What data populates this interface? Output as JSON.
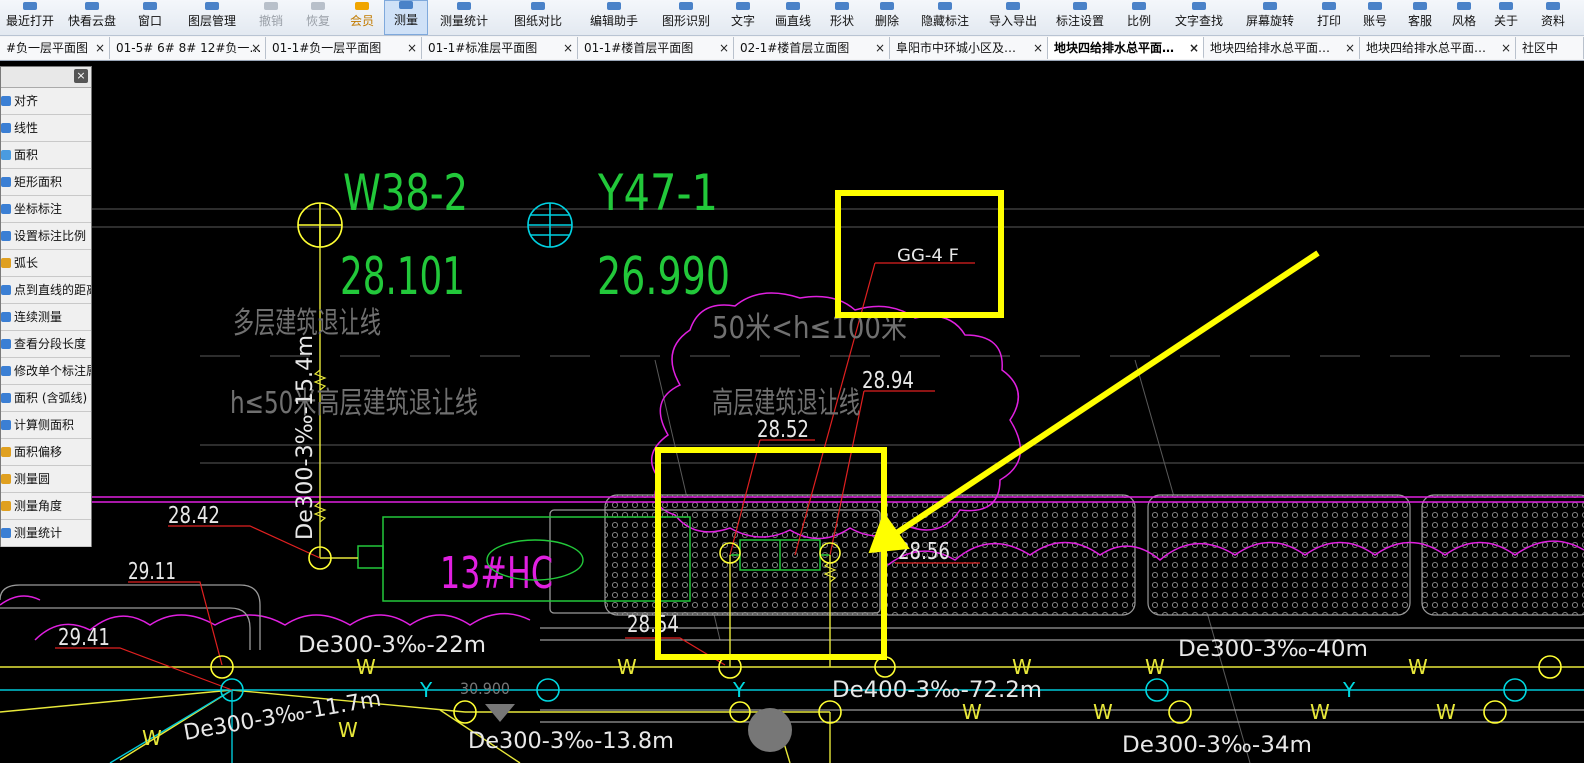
{
  "toolbar": {
    "items": [
      {
        "label": "最近打开",
        "state": "normal"
      },
      {
        "label": "快看云盘",
        "state": "normal"
      },
      {
        "label": "窗口",
        "state": "normal"
      },
      {
        "label": "图层管理",
        "state": "normal"
      },
      {
        "label": "撤销",
        "state": "disabled"
      },
      {
        "label": "恢复",
        "state": "disabled"
      },
      {
        "label": "会员",
        "state": "orange"
      },
      {
        "label": "测量",
        "state": "active"
      },
      {
        "label": "测量统计",
        "state": "normal"
      },
      {
        "label": "图纸对比",
        "state": "normal"
      },
      {
        "label": "编辑助手",
        "state": "normal"
      },
      {
        "label": "图形识别",
        "state": "normal"
      },
      {
        "label": "文字",
        "state": "normal"
      },
      {
        "label": "画直线",
        "state": "normal"
      },
      {
        "label": "形状",
        "state": "normal"
      },
      {
        "label": "删除",
        "state": "normal"
      },
      {
        "label": "隐藏标注",
        "state": "normal"
      },
      {
        "label": "导入导出",
        "state": "normal"
      },
      {
        "label": "标注设置",
        "state": "normal"
      },
      {
        "label": "比例",
        "state": "normal"
      },
      {
        "label": "文字查找",
        "state": "normal"
      },
      {
        "label": "屏幕旋转",
        "state": "normal"
      },
      {
        "label": "打印",
        "state": "normal"
      },
      {
        "label": "账号",
        "state": "normal"
      },
      {
        "label": "客服",
        "state": "normal"
      },
      {
        "label": "风格",
        "state": "normal"
      },
      {
        "label": "关于",
        "state": "normal"
      },
      {
        "label": "资料",
        "state": "normal"
      }
    ]
  },
  "tabs": {
    "items": [
      {
        "label": "#负一层平面图",
        "active": false
      },
      {
        "label": "01-5# 6# 8# 12#负一…",
        "active": false
      },
      {
        "label": "01-1#负一层平面图",
        "active": false
      },
      {
        "label": "01-1#标准层平面图",
        "active": false
      },
      {
        "label": "01-1#楼首层平面图",
        "active": false
      },
      {
        "label": "02-1#楼首层立面图",
        "active": false
      },
      {
        "label": "阜阳市中环城小区及…",
        "active": false
      },
      {
        "label": "地块四给排水总平面…",
        "active": true
      },
      {
        "label": "地块四给排水总平面…",
        "active": false
      },
      {
        "label": "地块四给排水总平面…",
        "active": false
      },
      {
        "label": "社区中",
        "active": false
      }
    ],
    "close_glyph": "×"
  },
  "measure_panel": {
    "close_glyph": "×",
    "items": [
      {
        "label": "对齐",
        "icon": "align-icon"
      },
      {
        "label": "线性",
        "icon": "linear-icon"
      },
      {
        "label": "面积",
        "icon": "area-icon"
      },
      {
        "label": "矩形面积",
        "icon": "rect-area-icon"
      },
      {
        "label": "坐标标注",
        "icon": "coordinate-icon"
      },
      {
        "label": "设置标注比例",
        "icon": "scale-icon"
      },
      {
        "label": "弧长",
        "icon": "arc-icon"
      },
      {
        "label": "点到直线的距离",
        "icon": "point-line-icon"
      },
      {
        "label": "连续测量",
        "icon": "continuous-icon"
      },
      {
        "label": "查看分段长度",
        "icon": "segment-icon"
      },
      {
        "label": "修改单个标注属性",
        "icon": "edit-icon"
      },
      {
        "label": "面积 (含弧线)",
        "icon": "arc-area-icon"
      },
      {
        "label": "计算侧面积",
        "icon": "side-area-icon"
      },
      {
        "label": "面积偏移",
        "icon": "offset-icon"
      },
      {
        "label": "测量圆",
        "icon": "circle-icon"
      },
      {
        "label": "测量角度",
        "icon": "angle-icon"
      },
      {
        "label": "测量统计",
        "icon": "stats-icon"
      }
    ]
  },
  "drawing": {
    "label_w38": "W38-2",
    "value_w38": "28.101",
    "label_y47": "Y47-1",
    "value_y47": "26.990",
    "setback_multi": "多层建筑退让线",
    "setback_h50": "h≤50米高层建筑退让线",
    "setback_range": "50米<h≤100米",
    "setback_high": "高层建筑退让线",
    "pipe_vertical": "De300-3‰-15.4m",
    "gg_label": "GG-4 F",
    "elev_2894": "28.94",
    "elev_2852": "28.52",
    "elev_2842": "28.42",
    "elev_2911": "29.11",
    "elev_2941": "29.41",
    "elev_2856": "28.56",
    "elev_2854": "28.54",
    "hc_label": "13#HC",
    "pipe_22": "De300-3‰-22m",
    "pipe_40": "De300-3‰-40m",
    "pipe_72": "De400-3‰-72.2m",
    "pipe_117": "De300-3‰-11.7m",
    "pipe_138": "De300-3‰-13.8m",
    "pipe_34": "De300-3‰-34m",
    "elev_30900": "30.900",
    "w_marker": "W",
    "y_marker": "Y",
    "colors": {
      "cad_green": "#22c83a",
      "cad_yellow": "#ffff33",
      "cad_magenta": "#e020e0",
      "cad_cyan": "#00d8e0",
      "cad_white": "#e8e8e8",
      "cad_gray": "#8a8a8a",
      "cad_red": "#e02020",
      "highlight": "#ffff00"
    }
  }
}
